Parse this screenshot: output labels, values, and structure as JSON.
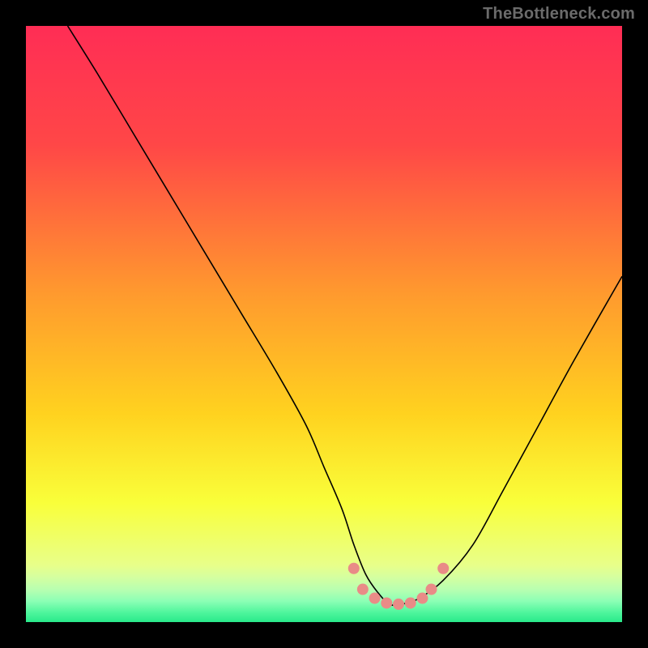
{
  "watermark": "TheBottleneck.com",
  "chart_data": {
    "type": "line",
    "title": "",
    "xlabel": "",
    "ylabel": "",
    "xlim": [
      0,
      100
    ],
    "ylim": [
      0,
      100
    ],
    "background_gradient": {
      "stops": [
        {
          "offset": 0.0,
          "color": "#ff2d55"
        },
        {
          "offset": 0.2,
          "color": "#ff4747"
        },
        {
          "offset": 0.45,
          "color": "#ff9a2e"
        },
        {
          "offset": 0.65,
          "color": "#ffd21f"
        },
        {
          "offset": 0.8,
          "color": "#f9ff3a"
        },
        {
          "offset": 0.905,
          "color": "#e8ff8a"
        },
        {
          "offset": 0.925,
          "color": "#d4ffa0"
        },
        {
          "offset": 0.945,
          "color": "#b9ffb0"
        },
        {
          "offset": 0.965,
          "color": "#8bffb5"
        },
        {
          "offset": 0.985,
          "color": "#4cf59b"
        },
        {
          "offset": 1.0,
          "color": "#29e98b"
        }
      ]
    },
    "series": [
      {
        "name": "bottleneck-curve",
        "color": "#000000",
        "width": 1.6,
        "x": [
          7,
          12,
          18,
          24,
          30,
          36,
          42,
          47,
          50,
          53,
          55,
          57,
          59,
          61,
          63,
          66,
          70,
          75,
          80,
          86,
          92,
          100
        ],
        "y": [
          100,
          92,
          82,
          72,
          62,
          52,
          42,
          33,
          26,
          19,
          13,
          8,
          5,
          3,
          3,
          4,
          7,
          13,
          22,
          33,
          44,
          58
        ]
      }
    ],
    "markers": {
      "name": "optimal-zone-markers",
      "color": "#e98b87",
      "radius": 7,
      "points": [
        {
          "x": 55.0,
          "y": 9.0
        },
        {
          "x": 56.5,
          "y": 5.5
        },
        {
          "x": 58.5,
          "y": 4.0
        },
        {
          "x": 60.5,
          "y": 3.2
        },
        {
          "x": 62.5,
          "y": 3.0
        },
        {
          "x": 64.5,
          "y": 3.2
        },
        {
          "x": 66.5,
          "y": 4.0
        },
        {
          "x": 68.0,
          "y": 5.5
        },
        {
          "x": 70.0,
          "y": 9.0
        }
      ]
    }
  }
}
